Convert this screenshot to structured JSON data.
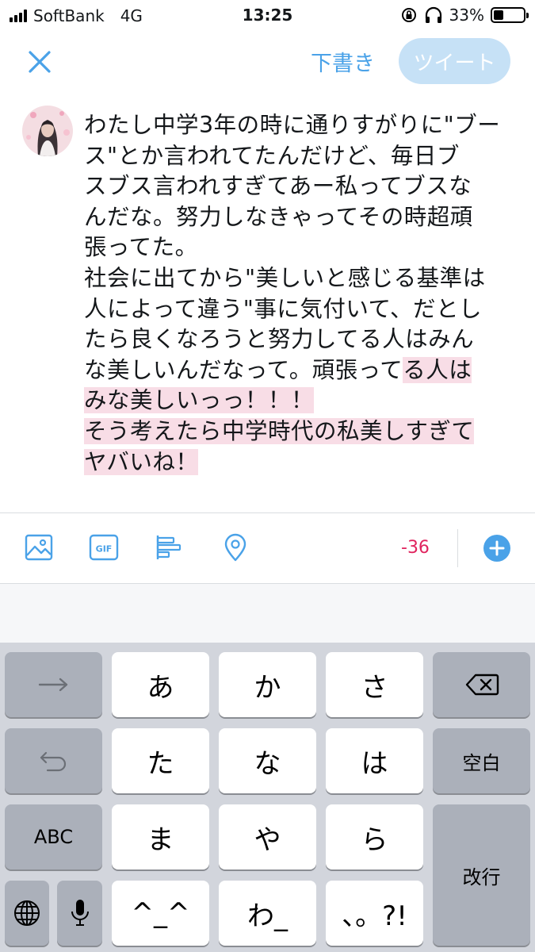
{
  "status_bar": {
    "carrier": "SoftBank",
    "network": "4G",
    "time": "13:25",
    "battery_percent": "33%",
    "battery_level": 0.33
  },
  "top_bar": {
    "drafts_label": "下書き",
    "tweet_label": "ツイート"
  },
  "composer": {
    "text_lines": [
      "わたし中学3年の時に通りすがりに\"ブー",
      "ス\"とか言われてたんだけど、毎日ブ",
      "スブス言われすぎてあー私ってブスな",
      "んだな。努力しなきゃってその時超頑",
      "張ってた。",
      "社会に出てから\"美しいと感じる基準は",
      "人によって違う\"事に気付いて、だとし",
      "たら良くなろうと努力してる人はみん"
    ],
    "mixed_line": {
      "normal": "な美しいんだなって。頑張って",
      "over": "る人は"
    },
    "over_lines": [
      "みな美しいっっ！！！",
      "そう考えたら中学時代の私美しすぎて",
      "ヤバいね！"
    ]
  },
  "toolbar": {
    "icons": [
      "image-icon",
      "gif-icon",
      "poll-icon",
      "location-icon"
    ],
    "char_counter": "-36",
    "accent_color": "#4aa2e8",
    "over_limit_color": "#e0245e"
  },
  "keyboard": {
    "row1": [
      "→",
      "あ",
      "か",
      "さ",
      "delete"
    ],
    "row2": [
      "undo",
      "た",
      "な",
      "は",
      "空白"
    ],
    "row3": [
      "ABC",
      "ま",
      "や",
      "ら"
    ],
    "row4": [
      "globe",
      "mic",
      "^_^",
      "わ_",
      "、。?!"
    ],
    "return_label": "改行"
  }
}
